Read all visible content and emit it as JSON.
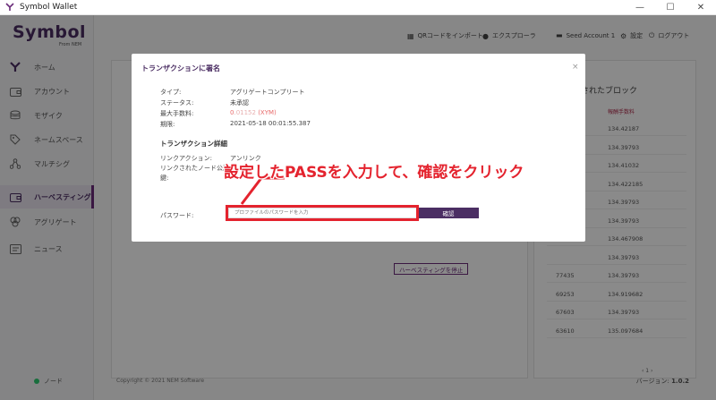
{
  "window": {
    "title": "Symbol Wallet",
    "minimize": "—",
    "maximize": "☐",
    "close": "✕"
  },
  "logo": {
    "text": "Symbol",
    "sub": "From NEM"
  },
  "header": {
    "qr_import": "QRコードをインポート",
    "explorer": "エクスプローラ",
    "account": "Seed Account 1",
    "settings": "設定",
    "logout": "ログアウト"
  },
  "sidebar": {
    "items": [
      {
        "label": "ホーム",
        "icon": "symbol-y-icon"
      },
      {
        "label": "アカウント",
        "icon": "wallet-icon"
      },
      {
        "label": "モザイク",
        "icon": "coins-icon"
      },
      {
        "label": "ネームスペース",
        "icon": "tag-icon"
      },
      {
        "label": "マルチシグ",
        "icon": "network-icon"
      },
      {
        "label": "ハーベスティング",
        "icon": "harvest-icon"
      },
      {
        "label": "アグリゲート",
        "icon": "aggregate-icon"
      },
      {
        "label": "ニュース",
        "icon": "news-icon"
      }
    ],
    "active_index": 5,
    "node": "ノード"
  },
  "right_panel": {
    "title": "されたブロック",
    "fee_header": "報酬手数料",
    "rows": [
      {
        "height": "",
        "fee": "134.42187"
      },
      {
        "height": "",
        "fee": "134.39793"
      },
      {
        "height": "",
        "fee": "134.41032"
      },
      {
        "height": "",
        "fee": "134.422185"
      },
      {
        "height": "",
        "fee": "134.39793"
      },
      {
        "height": "",
        "fee": "134.39793"
      },
      {
        "height": "",
        "fee": "134.467908"
      },
      {
        "height": "",
        "fee": "134.39793"
      },
      {
        "height": "77435",
        "fee": "134.39793"
      },
      {
        "height": "69253",
        "fee": "134.919682"
      },
      {
        "height": "67603",
        "fee": "134.39793"
      },
      {
        "height": "63610",
        "fee": "135.097684"
      }
    ],
    "pager": "‹  1  ›"
  },
  "left_panel": {
    "stop_harvest": "ハーベスティングを停止"
  },
  "footer": {
    "copyright": "Copyright © 2021 NEM Software",
    "version_label": "バージョン:",
    "version": "1.0.2"
  },
  "modal": {
    "title": "トランザクションに署名",
    "type_label": "タイプ:",
    "type_value": "アグリゲートコンプリート",
    "status_label": "ステータス:",
    "status_value": "未承認",
    "max_fee_label": "最大手数料:",
    "max_fee_int": "0",
    "max_fee_frac": ".01152",
    "max_fee_unit": "(XYM)",
    "deadline_label": "期限:",
    "deadline_value": "2021-05-18 00:01:55.387",
    "details_title": "トランザクション詳細",
    "link_action_label": "リンクアクション:",
    "link_action_value": "アンリンク",
    "linked_node_label_1": "リンクされたノード公開",
    "linked_node_label_2": "鍵:",
    "password_label": "パスワード:",
    "password_placeholder": "プロファイルのパスワードを入力",
    "confirm": "確認",
    "close": "×"
  },
  "annotation": {
    "text": "設定したPASSを入力して、確認をクリック",
    "color": "#e4232e"
  }
}
